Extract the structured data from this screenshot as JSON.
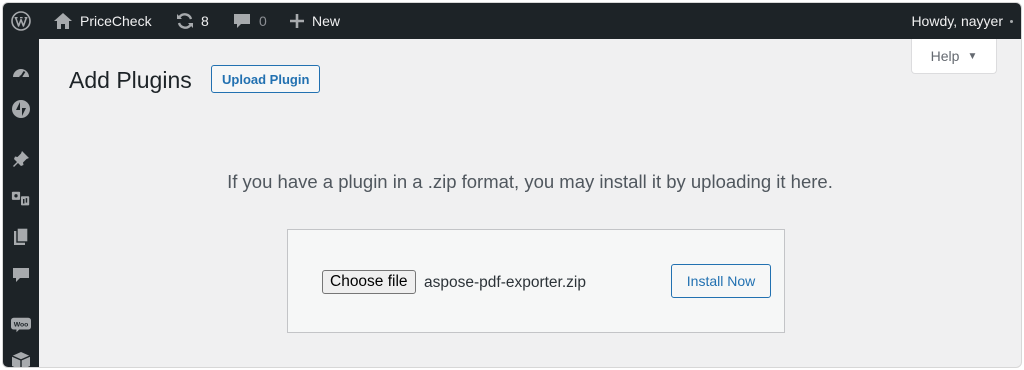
{
  "adminbar": {
    "site_name": "PriceCheck",
    "updates_count": "8",
    "comments_count": "0",
    "new_label": "New",
    "howdy": "Howdy, nayyer"
  },
  "sidebar": {
    "items": [
      {
        "icon": "dashboard-icon"
      },
      {
        "icon": "jetpack-icon"
      },
      {
        "icon": "pin-icon"
      },
      {
        "icon": "media-icon"
      },
      {
        "icon": "pages-icon"
      },
      {
        "icon": "comments-icon"
      },
      {
        "icon": "woo-icon",
        "label": "Woo"
      },
      {
        "icon": "box-icon"
      }
    ]
  },
  "header": {
    "title": "Add Plugins",
    "upload_label": "Upload Plugin",
    "help_label": "Help"
  },
  "upload": {
    "help_text": "If you have a plugin in a .zip format, you may install it by uploading it here.",
    "choose_label": "Choose file",
    "file_name": "aspose-pdf-exporter.zip",
    "install_label": "Install Now"
  },
  "colors": {
    "adminbar_bg": "#1d2327",
    "accent": "#2271b1",
    "page_bg": "#f0f0f1"
  }
}
